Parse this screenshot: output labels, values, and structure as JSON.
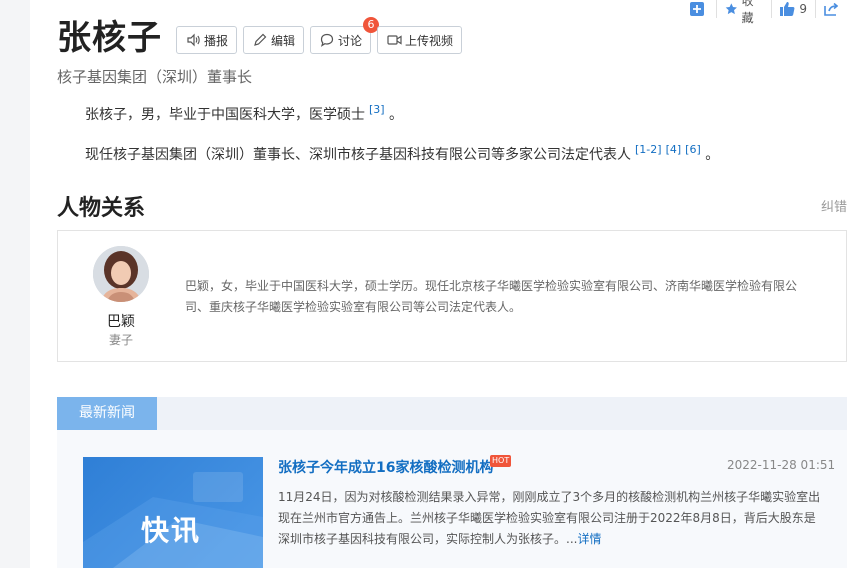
{
  "person": {
    "name": "张核子",
    "subtitle": "核子基因集团（深圳）董事长"
  },
  "actions": {
    "broadcast": "播报",
    "edit": "编辑",
    "discuss": "讨论",
    "discuss_count": "6",
    "upload_video": "上传视频"
  },
  "toolbar": {
    "favorite": "收藏",
    "like_count": "9"
  },
  "summary": {
    "p1_text": "张核子，男，毕业于中国医科大学，医学硕士",
    "p1_ref": "[3]",
    "p1_end": "。",
    "p2_text": "现任核子基因集团（深圳）董事长、深圳市核子基因科技有限公司等多家公司法定代表人",
    "p2_refs": [
      "[1-2]",
      "[4]",
      "[6]"
    ],
    "p2_end": "。"
  },
  "relations": {
    "title": "人物关系",
    "correction": "纠错",
    "items": [
      {
        "name": "巴颖",
        "role": "妻子",
        "desc": "巴颖，女，毕业于中国医科大学，硕士学历。现任北京核子华曦医学检验实验室有限公司、济南华曦医学检验有限公司、重庆核子华曦医学检验实验室有限公司等公司法定代表人。"
      }
    ]
  },
  "news": {
    "tab": "最新新闻",
    "items": [
      {
        "thumb_text": "快讯",
        "title": "张核子今年成立16家核酸检测机构",
        "hot": "HOT",
        "date": "2022-11-28 01:51",
        "body": "11月24日，因为对核酸检测结果录入异常，刚刚成立了3个多月的核酸检测机构兰州核子华曦实验室出现在兰州市官方通告上。兰州核子华曦医学检验实验室有限公司注册于2022年8月8日，背后大股东是深圳市核子基因科技有限公司，实际控制人为张核子。...",
        "more": "详情"
      }
    ]
  },
  "colors": {
    "link": "#136ec2",
    "tab": "#7bb4ec",
    "badge": "#f0553a"
  }
}
